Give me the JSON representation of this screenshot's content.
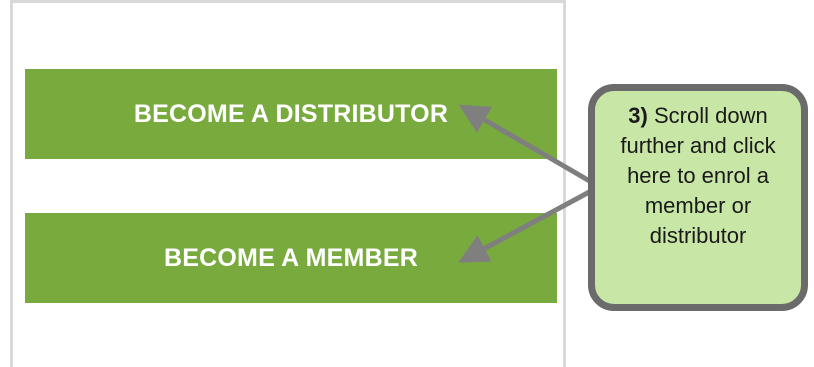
{
  "buttons": {
    "distributor_label": "BECOME A DISTRIBUTOR",
    "member_label": "BECOME A MEMBER"
  },
  "callout": {
    "step": "3)",
    "text": " Scroll down further and click here to enrol a member or distributor"
  },
  "colors": {
    "button_green": "#78aa3e",
    "callout_fill": "#c8e6a6",
    "callout_border": "#6b6b6b",
    "arrow": "#7f7f7f"
  },
  "icons": [
    "arrow-to-distributor-icon",
    "arrow-to-member-icon"
  ]
}
